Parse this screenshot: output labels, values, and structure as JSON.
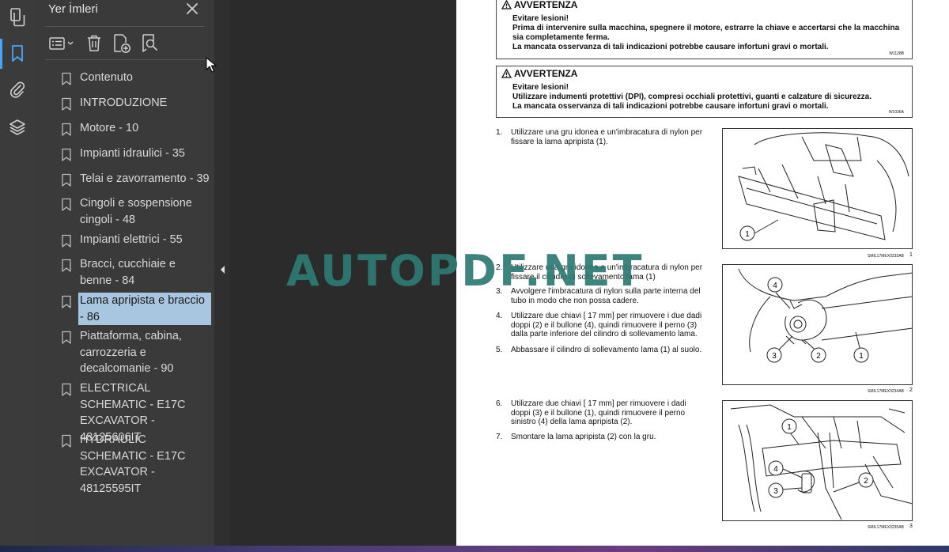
{
  "rail": {
    "icons": [
      "pages-icon",
      "bookmark-icon",
      "attachment-icon",
      "layers-icon"
    ]
  },
  "panel": {
    "title": "Yer İmleri",
    "close_icon": "close-icon",
    "toolbar": [
      "options-menu-icon",
      "delete-bookmark-icon",
      "add-bookmark-icon",
      "find-bookmark-icon"
    ],
    "bookmarks": [
      {
        "label": "Contenuto"
      },
      {
        "label": "INTRODUZIONE"
      },
      {
        "label": "Motore - 10"
      },
      {
        "label": "Impianti idraulici - 35"
      },
      {
        "label": "Telai e zavorramento - 39"
      },
      {
        "label": "Cingoli e sospensione cingoli - 48"
      },
      {
        "label": "Impianti elettrici - 55"
      },
      {
        "label": "Bracci, cucchiaie e benne - 84"
      },
      {
        "label": "Lama apripista e braccio - 86",
        "selected": true
      },
      {
        "label": "Piattaforma, cabina, carrozzeria e decalcomanie - 90"
      },
      {
        "label": "ELECTRICAL SCHEMATIC - E17C EXCAVATOR - 48125606IT"
      },
      {
        "label": "HYDRAULIC SCHEMATIC - E17C EXCAVATOR - 48125595IT"
      }
    ]
  },
  "page": {
    "warnings": [
      {
        "title": "AVVERTENZA",
        "lines": [
          "Evitare lesioni!",
          "Prima di intervenire sulla macchina, spegnere il motore, estrarre la chiave e accertarsi che la macchina sia completamente ferma.",
          "La mancata osservanza di tali indicazioni potrebbe causare infortuni gravi o mortali."
        ],
        "code": "W1128B"
      },
      {
        "title": "AVVERTENZA",
        "lines": [
          "Evitare lesioni!",
          "Utilizzare indumenti protettivi (DPI), compresi occhiali protettivi, guanti e calzature di sicurezza.",
          "La mancata osservanza di tali indicazioni potrebbe causare infortuni gravi o mortali."
        ],
        "code": "W1036A"
      }
    ],
    "steps": [
      {
        "n": "1.",
        "text": "Utilizzare una gru idonea e un'imbracatura di nylon per fissare la lama apripista (1)."
      },
      {
        "n": "2.",
        "text": "Utilizzare una gru idonea e un'imbracatura di nylon per fissare il cilindro di sollevamento lama (1)"
      },
      {
        "n": "3.",
        "text": "Avvolgere l'imbracatura di nylon sulla parte interna del tubo in modo che non possa cadere."
      },
      {
        "n": "4.",
        "text": "Utilizzare due chiavi [ 17 mm] per rimuovere i due dadi doppi (2) e il bullone (4), quindi rimuovere il perno (3) dalla parte inferiore del cilindro di sollevamento lama."
      },
      {
        "n": "5.",
        "text": "Abbassare il cilindro di sollevamento lama (1) al suolo."
      },
      {
        "n": "6.",
        "text": "Utilizzare due chiavi [ 17 mm] per rimuovere i dadi doppi (3) e il bullone (1), quindi rimuovere il perno sinistro (4) della lama apripista (2)."
      },
      {
        "n": "7.",
        "text": "Smontare la lama apripista (2) con la gru."
      }
    ],
    "figures": [
      {
        "caption": "SMIL17MEX0233AB",
        "number": "1",
        "callouts": [
          "1"
        ]
      },
      {
        "caption": "SMIL17MEX0234AB",
        "number": "2",
        "callouts": [
          "4",
          "3",
          "2",
          "1"
        ]
      },
      {
        "caption": "SMIL17MEX0235AB",
        "number": "3",
        "callouts": [
          "1",
          "4",
          "3",
          "2"
        ]
      }
    ]
  },
  "watermark": "AUTOPDF.NET",
  "colors": {
    "selection": "#a9c6e0",
    "accent": "#4aa3ff",
    "watermark": "#2e7a74"
  }
}
